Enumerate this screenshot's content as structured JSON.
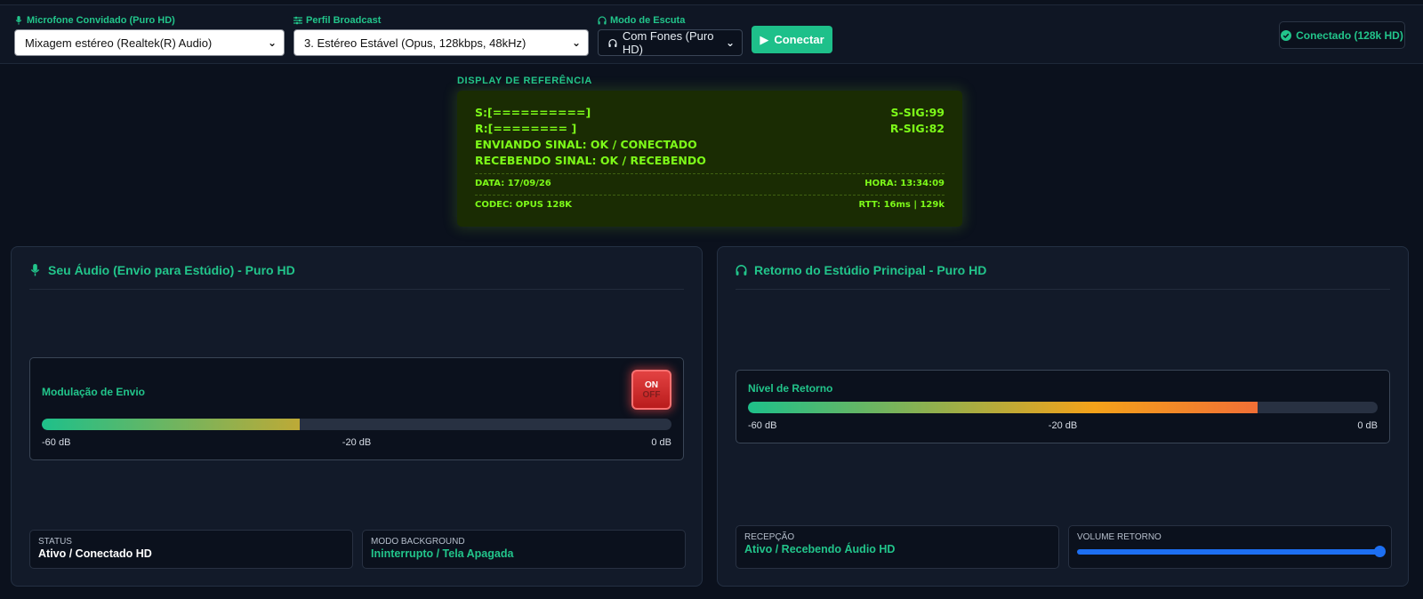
{
  "controls": {
    "mic": {
      "label": "Microfone Convidado (Puro HD)",
      "value": "Mixagem estéreo (Realtek(R) Audio)",
      "icon": "microphone-icon"
    },
    "profile": {
      "label": "Perfil Broadcast",
      "value": "3. Estéreo Estável (Opus, 128kbps, 48kHz)",
      "icon": "sliders-icon"
    },
    "listen": {
      "label": "Modo de Escuta",
      "value": "Com Fones (Puro HD)",
      "icon": "headphones-icon"
    },
    "connect_label": "Conectar",
    "status": "Conectado (128k HD)"
  },
  "display": {
    "title": "DISPLAY DE REFERÊNCIA",
    "send_bar": "S:[==========]",
    "send_sig": "S-SIG:99",
    "recv_bar": "R:[======== ]",
    "recv_sig": "R-SIG:82",
    "sending": "ENVIANDO SINAL: OK / CONECTADO",
    "receiving": "RECEBENDO SINAL: OK / RECEBENDO",
    "date": "DATA: 17/09/26",
    "time": "HORA: 13:34:09",
    "codec": "CODEC: OPUS 128K",
    "rtt": "RTT: 16ms | 129k"
  },
  "send_panel": {
    "title": "Seu Áudio (Envio para Estúdio) - Puro HD",
    "meter_label": "Modulação de Envio",
    "level": 0.41,
    "scale": [
      "-60 dB",
      "-20 dB",
      "0 dB"
    ],
    "toggle_on": "ON",
    "toggle_off": "OFF",
    "status_key": "STATUS",
    "status_value": "Ativo / Conectado HD",
    "bg_key": "MODO BACKGROUND",
    "bg_value": "Ininterrupto / Tela Apagada"
  },
  "return_panel": {
    "title": "Retorno do Estúdio Principal - Puro HD",
    "meter_label": "Nível de Retorno",
    "level": 0.81,
    "scale": [
      "-60 dB",
      "-20 dB",
      "0 dB"
    ],
    "reception_key": "RECEPÇÃO",
    "reception_value": "Ativo / Recebendo Áudio HD",
    "volume_key": "VOLUME RETORNO",
    "volume": 1.0
  },
  "colors": {
    "accent": "#22c58b",
    "lcd_text": "#7dfa19",
    "lcd_bg": "#1a2c03",
    "danger": "#ef4444",
    "slider": "#1d6ff2"
  }
}
